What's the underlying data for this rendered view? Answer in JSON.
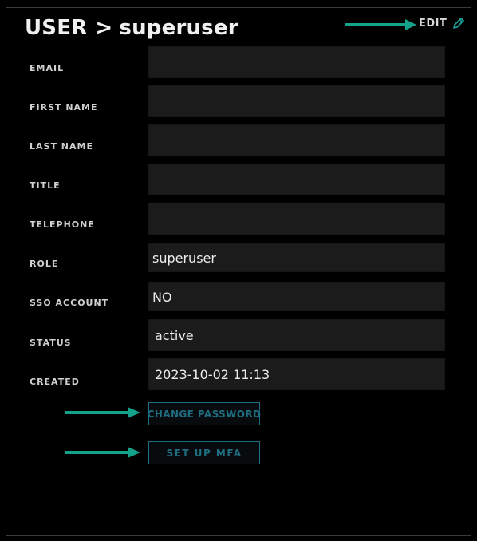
{
  "header": {
    "title_prefix": "USER",
    "separator": ">",
    "title_user": "superuser",
    "edit_label": "EDIT"
  },
  "fields": [
    {
      "label": "EMAIL",
      "value": ""
    },
    {
      "label": "FIRST NAME",
      "value": ""
    },
    {
      "label": "LAST NAME",
      "value": ""
    },
    {
      "label": "TITLE",
      "value": ""
    },
    {
      "label": "TELEPHONE",
      "value": ""
    },
    {
      "label": "ROLE",
      "value": "superuser"
    },
    {
      "label": "SSO ACCOUNT",
      "value": "NO"
    },
    {
      "label": "STATUS",
      "value": "active"
    },
    {
      "label": "CREATED",
      "value": "2023-10-02 11:13"
    }
  ],
  "actions": {
    "change_password_label": "CHANGE PASSWORD",
    "setup_mfa_label": "SET UP MFA"
  },
  "colors": {
    "accent_arrow": "#14a38a",
    "button_border": "#1c6e84",
    "button_text": "#1f6d80",
    "field_bg": "#1b1b1b"
  },
  "icons": {
    "edit": "pencil-icon",
    "arrow": "arrow-right-icon"
  }
}
